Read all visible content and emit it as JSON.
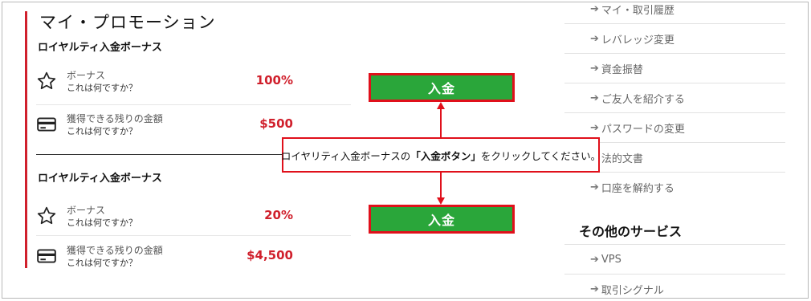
{
  "page": {
    "title": "マイ・プロモーション"
  },
  "promotions": [
    {
      "heading": "ロイヤルティ入金ボーナス",
      "bonus_label": "ボーナス",
      "bonus_help": "これは何ですか？",
      "bonus_value": "100%",
      "remaining_label": "獲得できる残りの金額",
      "remaining_help": "これは何ですか？",
      "remaining_value": "$500",
      "button_label": "入金"
    },
    {
      "heading": "ロイヤルティ入金ボーナス",
      "bonus_label": "ボーナス",
      "bonus_help": "これは何ですか？",
      "bonus_value": "20%",
      "remaining_label": "獲得できる残りの金額",
      "remaining_help": "これは何ですか？",
      "remaining_value": "$4,500",
      "button_label": "入金"
    }
  ],
  "callout": {
    "before": "ロイヤリティ入金ボーナスの",
    "emphasis": "「入金ボタン」",
    "after": "をクリックしてください。"
  },
  "sidebar": {
    "items": [
      {
        "label": "マイ・取引履歴"
      },
      {
        "label": "レバレッジ変更"
      },
      {
        "label": "資金振替"
      },
      {
        "label": "ご友人を紹介する"
      },
      {
        "label": "パスワードの変更"
      },
      {
        "label": "法的文書"
      },
      {
        "label": "口座を解約する"
      }
    ],
    "other_heading": "その他のサービス",
    "other_items": [
      {
        "label": "VPS"
      },
      {
        "label": "取引シグナル"
      }
    ]
  },
  "colors": {
    "accent_red": "#d0202c",
    "button_green": "#2aa63a"
  }
}
